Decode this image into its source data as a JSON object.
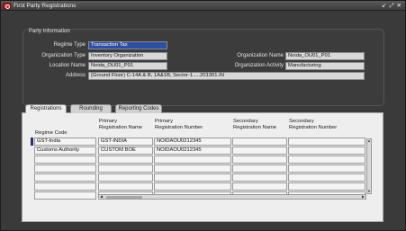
{
  "window": {
    "title": "First Party Registrations",
    "controls": [
      "↙",
      "⤢",
      "✕"
    ]
  },
  "party_info": {
    "section_label": "Party Information",
    "regime_type_label": "Regime Type",
    "regime_type_value": "Transaction Tax",
    "org_type_label": "Organization Type",
    "org_type_value": "Inventory Organization",
    "org_name_label": "Organization Name",
    "org_name_value": "Noida_OU01_P01",
    "location_label": "Location Name",
    "location_value": "Noida_OU01_P01",
    "org_activity_label": "Organization Activity",
    "org_activity_value": "Manufacturing",
    "address_label": "Address",
    "address_value": "(Ground Floor) C-14A & B, 1A&1B, Sector-1.....201301.IN"
  },
  "tabs": [
    {
      "label": "Registrations",
      "active": true
    },
    {
      "label": "Rounding",
      "active": false
    },
    {
      "label": "Reporting Codes",
      "active": false
    }
  ],
  "grid": {
    "headers": {
      "regime_code": "Regime Code",
      "primary_reg_name": "Primary\nRegistration Name",
      "primary_reg_number": "Primary\nRegistration Number",
      "secondary_reg_name": "Secondary\nRegistration Name",
      "secondary_reg_number": "Secondary\nRegistration Number"
    },
    "rows": [
      {
        "regime_code": "GST-India",
        "primary_reg_name": "GST-INDIA",
        "primary_reg_number": "NOIDAOU0212345",
        "secondary_reg_name": "",
        "secondary_reg_number": ""
      },
      {
        "regime_code": "Customs Authority",
        "primary_reg_name": "CUSTOM BOE",
        "primary_reg_number": "NOIDAOU0212345",
        "secondary_reg_name": "",
        "secondary_reg_number": ""
      },
      {
        "regime_code": "",
        "primary_reg_name": "",
        "primary_reg_number": "",
        "secondary_reg_name": "",
        "secondary_reg_number": ""
      },
      {
        "regime_code": "",
        "primary_reg_name": "",
        "primary_reg_number": "",
        "secondary_reg_name": "",
        "secondary_reg_number": ""
      },
      {
        "regime_code": "",
        "primary_reg_name": "",
        "primary_reg_number": "",
        "secondary_reg_name": "",
        "secondary_reg_number": ""
      },
      {
        "regime_code": "",
        "primary_reg_name": "",
        "primary_reg_number": "",
        "secondary_reg_name": "",
        "secondary_reg_number": ""
      },
      {
        "regime_code": "",
        "primary_reg_name": "",
        "primary_reg_number": "",
        "secondary_reg_name": "",
        "secondary_reg_number": ""
      }
    ]
  },
  "colors": {
    "selection": "#2c4fa8",
    "app_icon": "#c8241f"
  }
}
